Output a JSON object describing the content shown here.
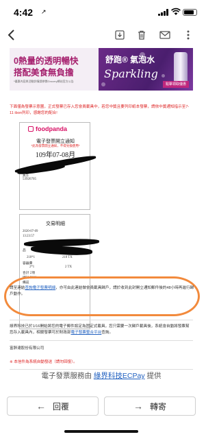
{
  "status": {
    "time": "4:42",
    "location_arrow": "↗"
  },
  "toolbar": {
    "back_icon": "chevron-left",
    "icons": [
      "download-icon",
      "trash-icon",
      "mail-icon",
      "more-icon"
    ]
  },
  "banner": {
    "headline1": "0熱量的透明暢快",
    "headline2": "搭配美食無負擔",
    "fine_print": "*優惠內容與活動詳情請參閱Grocery網站官方公告",
    "brand": "舒跑® 氣泡水",
    "brand_script": "Sparkling",
    "cta": "點擊領取優惠"
  },
  "notice": "下面僅為發票示意圖，正式發票已存入您會員載具中，若您中獎且要列印紙本發票，請依中獎通知指示至7-11 ibon列印，感謝您的配合!",
  "invoice": {
    "logo": "foodpanda",
    "title": "電子發票開立通知",
    "subtitle": "*此為發票開立通知，不得兌換使用*",
    "date": "109年07-08月",
    "buyer_label": "買方",
    "buyer_value": "53926705",
    "detail_title": "交易明細",
    "detail_datetime_1": "2020-07-09",
    "detail_datetime_2": "13:23:57",
    "detail_item_label": "品",
    "detail_q1": "218*1",
    "detail_q1_total": "218 TX",
    "detail_disc_label": "容器費",
    "detail_q2": "2*1",
    "detail_q2_total": "2 TX",
    "detail_total_label": "合計 2項",
    "detail_sum": "總計 $220",
    "detail_remark": "備註"
  },
  "hint": {
    "before": "請至連結",
    "link": "查詢電子發票明細",
    "after": "，亦可由此連結做會員載具歸戶，請於收到此封開立通知郵件後的48小時再進行歸戶動作。"
  },
  "paragraph": {
    "before": "綠界科技已於1/16開始將您的電子郵件設定為固定式載具，您只需要一次歸戶載具後，系統會自動將發票幫您存入載具內，相關發票可於財政部",
    "link": "電子發票整合平台",
    "after": "查詢。"
  },
  "company": "富胖達股份有限公司",
  "system_note": "※ 本信件為系統自動發送（請勿回復）。",
  "footer": {
    "prefix": "電子發票服務由 ",
    "link": "綠界科技ECPay",
    "suffix": " 提供"
  },
  "actions": {
    "reply": "回覆",
    "forward": "轉寄"
  },
  "colors": {
    "brand_pink": "#d70f64",
    "highlight_oval": "#f28a3c",
    "link": "#2060c0",
    "warning": "#d22222"
  }
}
